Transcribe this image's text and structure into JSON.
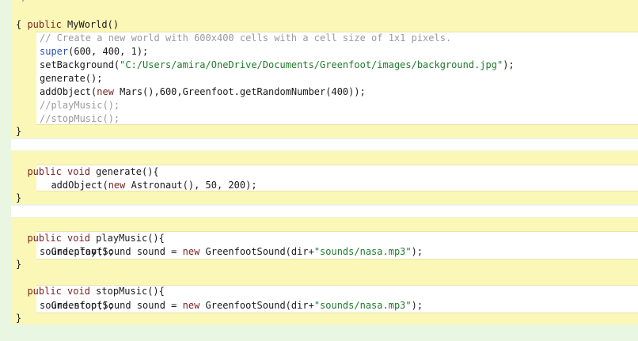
{
  "editor": {
    "top_fragment": "*/",
    "constructor": {
      "signature_kw": "public",
      "signature_rest": " MyWorld()",
      "open": "{",
      "close": "}",
      "body": [
        "// Create a new world with 600x400 cells with a cell size of 1x1 pixels.",
        "super(600, 400, 1);",
        "setBackground(\"C:/Users/amira/OneDrive/Documents/Greenfoot/images/background.jpg\");",
        "generate();",
        "addObject(new Mars(),600,Greenfoot.getRandomNumber(400));",
        "//playMusic();",
        "//stopMusic();"
      ]
    },
    "generate": {
      "kw1": "public",
      "kw2": "void",
      "name": " generate(){",
      "close": "}",
      "body_prefix": "addObject(",
      "body_kw": "new",
      "body_rest": " Astronaut(), 50, 200);"
    },
    "playMusic": {
      "kw1": "public",
      "kw2": "void",
      "name": " playMusic(){",
      "close": "}",
      "line1_a": "GreenfootSound sound = ",
      "line1_kw": "new",
      "line1_b": " GreenfootSound(dir+",
      "line1_str": "\"sounds/nasa.mp3\"",
      "line1_c": ");",
      "line2": "sound.play();"
    },
    "stopMusic": {
      "kw1": "public",
      "kw2": "void",
      "name": " stopMusic(){",
      "close": "}",
      "line1_a": "GreenfootSound sound = ",
      "line1_kw": "new",
      "line1_b": " GreenfootSound(dir+",
      "line1_str": "\"sounds/nasa.mp3\"",
      "line1_c": ");",
      "line2": "sound.stop();"
    }
  },
  "colors": {
    "background": "#e8f6e2",
    "block": "#fbf7b7",
    "keyword": "#7a1f1f",
    "string": "#1f7a2a",
    "comment": "#9a9a9a"
  }
}
